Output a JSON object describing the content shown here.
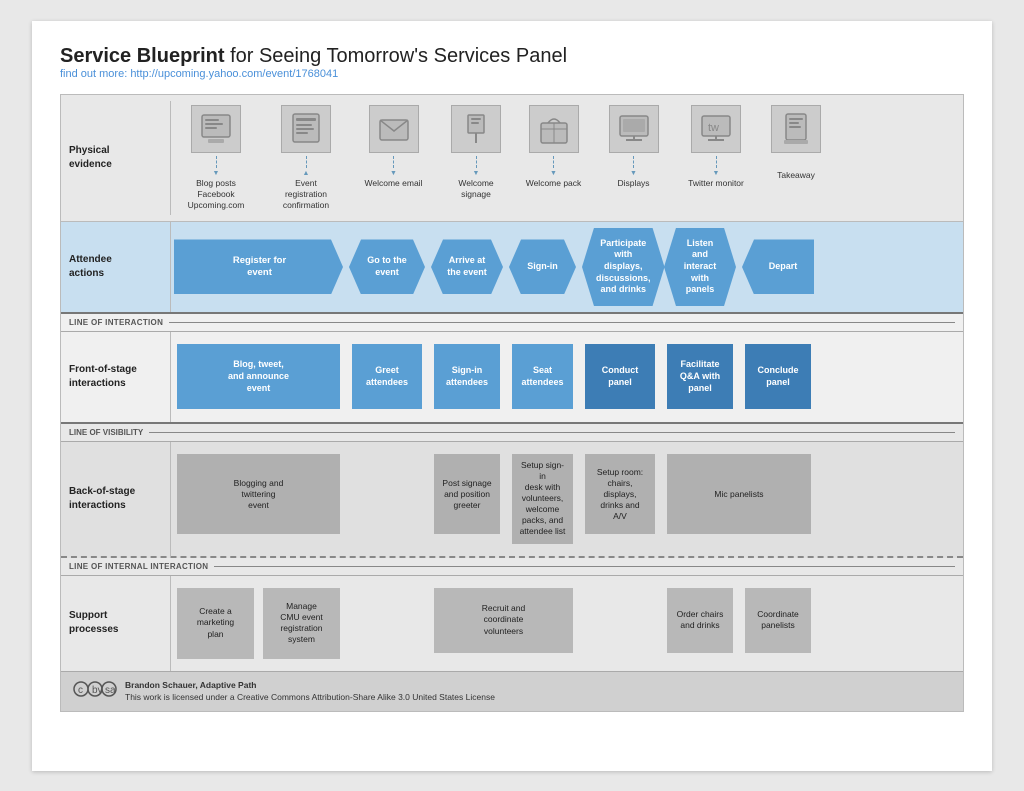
{
  "title": {
    "bold_part": "Service Blueprint",
    "rest_part": " for Seeing Tomorrow's Services Panel",
    "link_text": "find out more: http://upcoming.yahoo.com/event/1768041"
  },
  "physical_evidence": {
    "label": "Physical\nevidence",
    "items": [
      {
        "id": "blog-posts",
        "icon": "📰",
        "text": "Blog posts\nFacebook\nUpcoming.com",
        "has_arrow_up": false,
        "has_arrow_down": true,
        "dashed": true
      },
      {
        "id": "event-reg",
        "icon": "🖥",
        "text": "Event\nregistration\nconfirmation",
        "has_arrow_up": true,
        "has_arrow_down": false,
        "dashed": true
      },
      {
        "id": "welcome-email",
        "icon": "✉",
        "text": "Welcome email",
        "has_arrow_up": false,
        "has_arrow_down": true,
        "dashed": true
      },
      {
        "id": "welcome-signage",
        "icon": "🪧",
        "text": "Welcome\nsignage",
        "has_arrow_up": false,
        "has_arrow_down": true,
        "dashed": true
      },
      {
        "id": "welcome-pack",
        "icon": "📦",
        "text": "Welcome pack",
        "has_arrow_up": false,
        "has_arrow_down": true,
        "dashed": true
      },
      {
        "id": "displays",
        "icon": "🖼",
        "text": "Displays",
        "has_arrow_up": false,
        "has_arrow_down": true,
        "dashed": true
      },
      {
        "id": "twitter-monitor",
        "icon": "📺",
        "text": "Twitter monitor",
        "has_arrow_up": false,
        "has_arrow_down": true,
        "dashed": true
      },
      {
        "id": "takeaway",
        "icon": "📄",
        "text": "Takeaway",
        "has_arrow_up": false,
        "has_arrow_down": false,
        "dashed": false
      }
    ]
  },
  "attendee_actions": {
    "label": "Attendee\nactions",
    "items": [
      {
        "id": "register",
        "text": "Register for\nevent",
        "type": "first-arrow",
        "span": 2
      },
      {
        "id": "go-to-event",
        "text": "Go to the event",
        "type": "mid-arrow"
      },
      {
        "id": "arrive",
        "text": "Arrive at the\nevent",
        "type": "mid-arrow"
      },
      {
        "id": "sign-in",
        "text": "Sign-in",
        "type": "mid-arrow"
      },
      {
        "id": "participate",
        "text": "Participate\nwith displays,\ndiscussions,\nand drinks",
        "type": "mid-arrow"
      },
      {
        "id": "listen",
        "text": "Listen and\ninteract with\npanels",
        "type": "mid-arrow"
      },
      {
        "id": "depart",
        "text": "Depart",
        "type": "last-arrow"
      }
    ]
  },
  "line_of_interaction": "LINE OF INTERACTION",
  "front_stage": {
    "label": "Front-of-stage\ninteractions",
    "items": [
      {
        "id": "blog-tweet",
        "text": "Blog, tweet,\nand announce\nevent",
        "span": 2,
        "dark": false
      },
      {
        "id": "greet",
        "text": "Greet\nattendees",
        "span": 1,
        "dark": false
      },
      {
        "id": "signin-att",
        "text": "Sign-in\nattendees",
        "span": 1,
        "dark": false
      },
      {
        "id": "seat-att",
        "text": "Seat\nattendees",
        "span": 1,
        "dark": false
      },
      {
        "id": "conduct",
        "text": "Conduct\npanel",
        "span": 1,
        "dark": true
      },
      {
        "id": "facilitate",
        "text": "Facilitate\nQ&A with\npanel",
        "span": 1,
        "dark": true
      },
      {
        "id": "conclude",
        "text": "Conclude\npanel",
        "span": 1,
        "dark": true
      }
    ]
  },
  "line_of_visibility": "LINE OF VISIBILITY",
  "back_stage": {
    "label": "Back-of-stage\ninteractions",
    "items": [
      {
        "id": "blogging",
        "text": "Blogging and\ntwittering\nevent",
        "span": 2
      },
      {
        "id": "empty-1",
        "text": "",
        "span": 1,
        "empty": true
      },
      {
        "id": "post-signage",
        "text": "Post signage\nand position\ngreeter",
        "span": 1
      },
      {
        "id": "setup-signin",
        "text": "Setup sign-in\ndesk with\nvolunteers,\nwelcome\npacks, and\nattendee list",
        "span": 1
      },
      {
        "id": "setup-room",
        "text": "Setup room:\nchairs,\ndisplays,\ndrinks and\nA/V",
        "span": 1
      },
      {
        "id": "mic-panelists",
        "text": "Mic panelists",
        "span": 2
      },
      {
        "id": "empty-2",
        "text": "",
        "span": 1,
        "empty": true
      }
    ]
  },
  "line_of_internal": "LINE OF INTERNAL INTERACTION",
  "support": {
    "label": "Support\nprocesses",
    "items": [
      {
        "id": "marketing",
        "text": "Create a\nmarketing\nplan",
        "span": 1
      },
      {
        "id": "cmu",
        "text": "Manage\nCMU event\nregistration\nsystem",
        "span": 1
      },
      {
        "id": "empty-1",
        "text": "",
        "span": 1,
        "empty": true
      },
      {
        "id": "recruit",
        "text": "Recruit and\ncoordinate\nvolunteers",
        "span": 2
      },
      {
        "id": "empty-2",
        "text": "",
        "span": 1,
        "empty": true
      },
      {
        "id": "order-chairs",
        "text": "Order chairs\nand drinks",
        "span": 1
      },
      {
        "id": "coord-panelists",
        "text": "Coordinate\npanelists",
        "span": 1
      },
      {
        "id": "empty-3",
        "text": "",
        "span": 1,
        "empty": true
      }
    ]
  },
  "footer": {
    "author": "Brandon Schauer, Adaptive Path",
    "license": "This work is licensed under a Creative Commons Attribution-Share Alike 3.0 United States License"
  }
}
